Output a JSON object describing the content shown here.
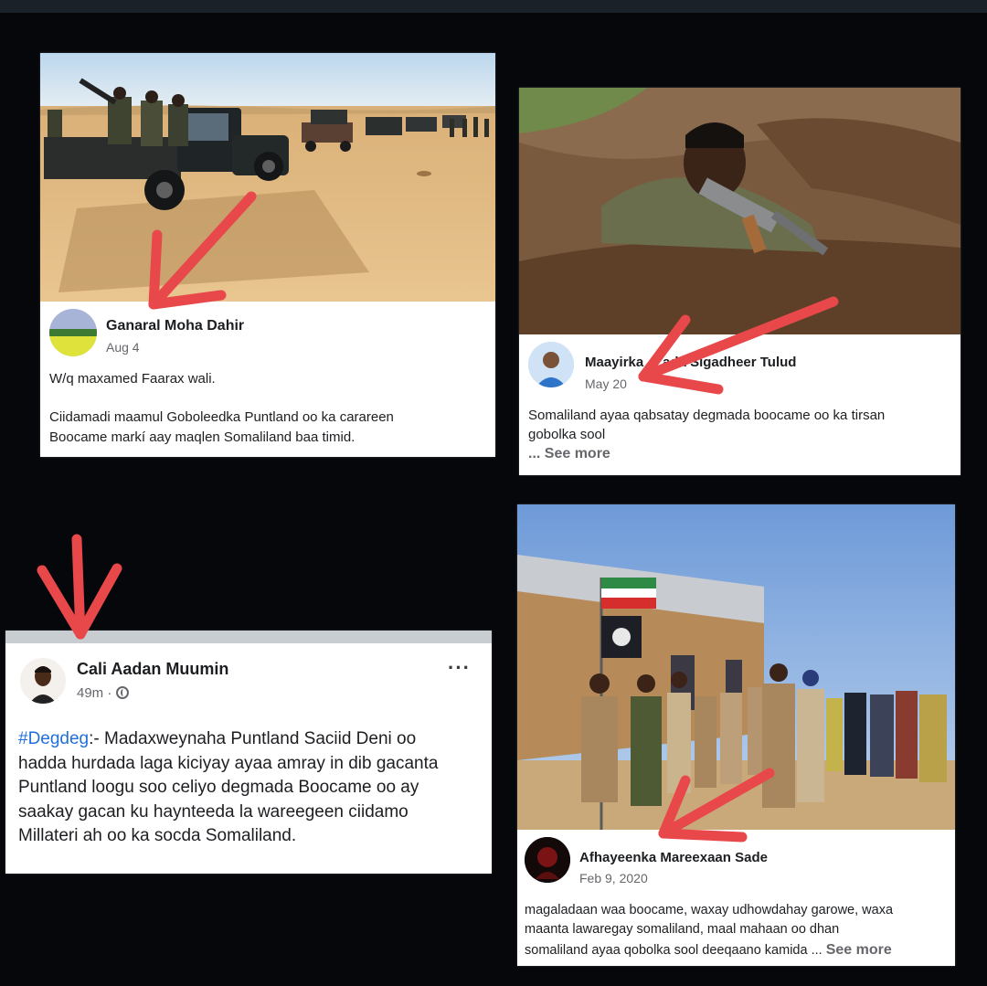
{
  "posts": [
    {
      "author": "Ganaral Moha Dahir",
      "date": "Aug 4",
      "line1": "W/q maxamed Faarax wali.",
      "line2": "Ciidamadi maamul Goboleedka Puntland oo ka carareen",
      "line3": "Boocame markí aay maqlen Somaliland baa timid."
    },
    {
      "author": "Maayirka ... ada Sigadheer Tulud",
      "date": "May 20",
      "line1": "Somaliland ayaa qabsatay degmada boocame oo ka tirsan",
      "line2": "gobolka sool",
      "see_more": "... See more"
    },
    {
      "author": "Cali Aadan Muumin",
      "date": "49m · ",
      "globe_icon": "globe-icon",
      "more_icon": "more-dots-icon",
      "hashtag": "#Degdeg",
      "line1_rest": ":- Madaxweynaha Puntland Saciid Deni oo",
      "line2": "hadda hurdada laga kiciyay ayaa amray in dib gacanta",
      "line3": "Puntland loogu soo celiyo degmada Boocame oo ay",
      "line4": "saakay gacan ku haynteeda la wareegeen ciidamo",
      "line5": "Millateri ah oo ka socda Somaliland."
    },
    {
      "author": "Afhayeenka Mareexaan Sade",
      "date": "Feb 9, 2020",
      "line1": "magaladaan waa boocame, waxay udhowdahay garowe, waxa",
      "line2": "maanta lawaregay somaliland, maal mahaan oo dhan",
      "line3": "somaliland ayaa qobolka sool deeqaano kamida ...",
      "see_more": "See more"
    }
  ],
  "colors": {
    "background": "#05070b",
    "arrow": "#e8484a",
    "link": "#216fdb"
  }
}
